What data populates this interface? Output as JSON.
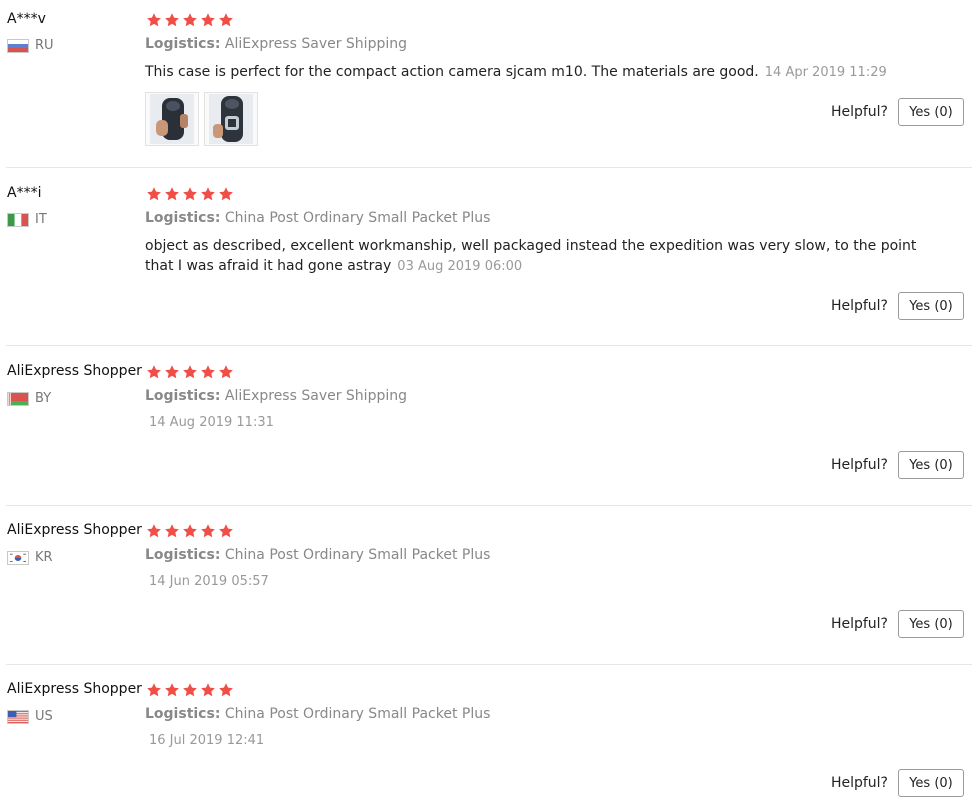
{
  "colors": {
    "star": "#f04e46",
    "muted": "#888888",
    "divider": "#e6e6e6"
  },
  "logistics_label": "Logistics:",
  "helpful_label": "Helpful?",
  "reviews": [
    {
      "user": "A***v",
      "country": "RU",
      "flag": "russia-flag-icon",
      "rating": 5,
      "logistics": "AliExpress Saver Shipping",
      "text": "This case is perfect for the compact action camera sjcam m10. The materials are good.",
      "date": "14 Apr 2019 11:29",
      "helpful_button": "Yes (0)",
      "photos": [
        "photo-1",
        "photo-2"
      ]
    },
    {
      "user": "A***i",
      "country": "IT",
      "flag": "italy-flag-icon",
      "rating": 5,
      "logistics": "China Post Ordinary Small Packet Plus",
      "text": "object as described, excellent workmanship, well packaged instead the expedition was very slow, to the point that I was afraid it had gone astray",
      "date": "03 Aug 2019 06:00",
      "helpful_button": "Yes (0)"
    },
    {
      "user": "AliExpress Shopper",
      "country": "BY",
      "flag": "belarus-flag-icon",
      "rating": 5,
      "logistics": "AliExpress Saver Shipping",
      "date": "14 Aug 2019 11:31",
      "helpful_button": "Yes (0)"
    },
    {
      "user": "AliExpress Shopper",
      "country": "KR",
      "flag": "korea-flag-icon",
      "rating": 5,
      "logistics": "China Post Ordinary Small Packet Plus",
      "date": "14 Jun 2019 05:57",
      "helpful_button": "Yes (0)"
    },
    {
      "user": "AliExpress Shopper",
      "country": "US",
      "flag": "usa-flag-icon",
      "rating": 5,
      "logistics": "China Post Ordinary Small Packet Plus",
      "date": "16 Jul 2019 12:41",
      "helpful_button": "Yes (0)"
    }
  ]
}
